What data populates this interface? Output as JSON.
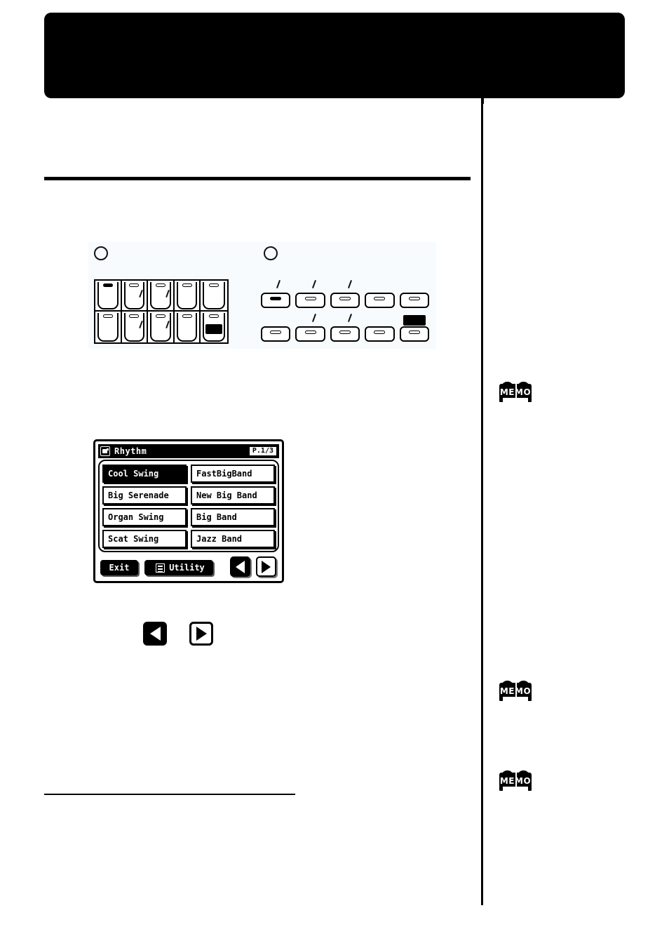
{
  "page": {
    "banner": {
      "title": ""
    },
    "section_rule": true,
    "footnote_rule": true
  },
  "panel_figure": {
    "step_markers": [
      {
        "name": "step-1",
        "label": ""
      },
      {
        "name": "step-2",
        "label": ""
      }
    ],
    "left_group": {
      "name": "tone-button-matrix",
      "rows": 2,
      "cols": 5,
      "buttons": [
        {
          "led": "on",
          "slash": false,
          "highlight": false
        },
        {
          "led": "off",
          "slash": true,
          "highlight": false
        },
        {
          "led": "off",
          "slash": true,
          "highlight": false
        },
        {
          "led": "off",
          "slash": false,
          "highlight": false
        },
        {
          "led": "off",
          "slash": false,
          "highlight": false
        },
        {
          "led": "off",
          "slash": false,
          "highlight": false
        },
        {
          "led": "off",
          "slash": true,
          "highlight": false
        },
        {
          "led": "off",
          "slash": true,
          "highlight": false
        },
        {
          "led": "off",
          "slash": false,
          "highlight": false
        },
        {
          "led": "off",
          "slash": false,
          "highlight": true
        }
      ]
    },
    "right_group": {
      "name": "rhythm-button-bank",
      "rows": [
        {
          "buttons": [
            {
              "led": "on",
              "tick": false,
              "highlight": false
            },
            {
              "led": "off",
              "tick": true,
              "highlight": false
            },
            {
              "led": "off",
              "tick": true,
              "highlight": false
            },
            {
              "led": "off",
              "tick": true,
              "highlight": false
            },
            {
              "led": "off",
              "tick": false,
              "highlight": false
            }
          ]
        },
        {
          "buttons": [
            {
              "led": "off",
              "tick": false,
              "highlight": false
            },
            {
              "led": "off",
              "tick": true,
              "highlight": false
            },
            {
              "led": "off",
              "tick": true,
              "highlight": false
            },
            {
              "led": "off",
              "tick": false,
              "highlight": false
            },
            {
              "led": "off",
              "tick": false,
              "highlight": true
            }
          ]
        }
      ]
    }
  },
  "lcd": {
    "title": "Rhythm",
    "page_indicator": "P.1/3",
    "icon": "rhythm-icon",
    "items": [
      {
        "label": "Cool Swing",
        "selected": true
      },
      {
        "label": "FastBigBand",
        "selected": false
      },
      {
        "label": "Big Serenade",
        "selected": false
      },
      {
        "label": "New Big Band",
        "selected": false
      },
      {
        "label": "Organ Swing",
        "selected": false
      },
      {
        "label": "Big Band",
        "selected": false
      },
      {
        "label": "Scat Swing",
        "selected": false
      },
      {
        "label": "Jazz Band",
        "selected": false
      }
    ],
    "footer": {
      "exit_label": "Exit",
      "utility_label": "Utility",
      "prev_icon": "triangle-left-icon",
      "next_icon": "triangle-right-icon"
    }
  },
  "inline_arrows": {
    "prev_icon": "triangle-left-icon",
    "next_icon": "triangle-right-icon"
  },
  "sidebar": {
    "memos": [
      {
        "label": "MEMO"
      },
      {
        "label": "MEMO"
      },
      {
        "label": "MEMO"
      }
    ]
  },
  "colors": {
    "ink": "#000000",
    "paper": "#ffffff",
    "panel_bg": "#f7fbfd"
  }
}
